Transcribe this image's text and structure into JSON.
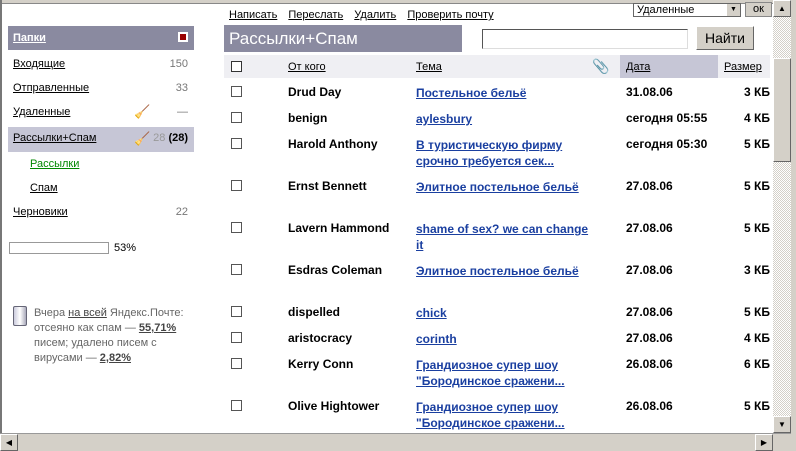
{
  "toolbar": {
    "compose": "Написать",
    "forward": "Переслать",
    "delete": "Удалить",
    "check": "Проверить почту",
    "move_target": "Удаленные",
    "ok": "ок"
  },
  "sidebar": {
    "title": "Папки",
    "folders": [
      {
        "label": "Входящие",
        "count": "150"
      },
      {
        "label": "Отправленные",
        "count": "33"
      },
      {
        "label": "Удаленные",
        "count": "—"
      },
      {
        "label": "Рассылки+Спам",
        "count": "28",
        "unread": "(28)"
      },
      {
        "label": "Рассылки"
      },
      {
        "label": "Спам"
      },
      {
        "label": "Черновики",
        "count": "22"
      }
    ],
    "quota_percent": 53,
    "quota_label": "53%",
    "stats": {
      "t1": "Вчера ",
      "link": "на всей",
      "t2": " Яндекс.Почте: отсеяно как спам — ",
      "spam": "55,71%",
      "t3": " писем; удалено писем с вирусами — ",
      "virus": "2,82%"
    }
  },
  "main": {
    "title": "Рассылки+Спам",
    "search_value": "",
    "find": "Найти",
    "columns": {
      "from": "От кого",
      "subject": "Тема",
      "date": "Дата",
      "size": "Размер"
    },
    "rows": [
      {
        "from": "Drud Day",
        "subject": "Постельное бельё",
        "date": "31.08.06",
        "size": "3 КБ"
      },
      {
        "from": "benign",
        "subject": "aylesbury",
        "date": "сегодня 05:55",
        "size": "4 КБ"
      },
      {
        "from": "Harold Anthony",
        "subject": "В туристическую фирму срочно требуется сек...",
        "date": "сегодня 05:30",
        "size": "5 КБ"
      },
      {
        "from": "Ernst Bennett",
        "subject": "Элитное постельное бельё",
        "date": "27.08.06",
        "size": "5 КБ"
      },
      {
        "from": "Lavern Hammond",
        "subject": "shame of sex? we can change it",
        "date": "27.08.06",
        "size": "5 КБ"
      },
      {
        "from": "Esdras Coleman",
        "subject": "Элитное постельное бельё",
        "date": "27.08.06",
        "size": "3 КБ"
      },
      {
        "from": "dispelled",
        "subject": "chick",
        "date": "27.08.06",
        "size": "5 КБ"
      },
      {
        "from": "aristocracy",
        "subject": "corinth",
        "date": "27.08.06",
        "size": "4 КБ"
      },
      {
        "from": "Kerry Conn",
        "subject": "Грандиозное супер шоу \"Бородинское сражени...",
        "date": "26.08.06",
        "size": "6 КБ"
      },
      {
        "from": "Olive Hightower",
        "subject": "Грандиозное супер шоу \"Бородинское сражени...",
        "date": "26.08.06",
        "size": "5 КБ"
      }
    ]
  }
}
